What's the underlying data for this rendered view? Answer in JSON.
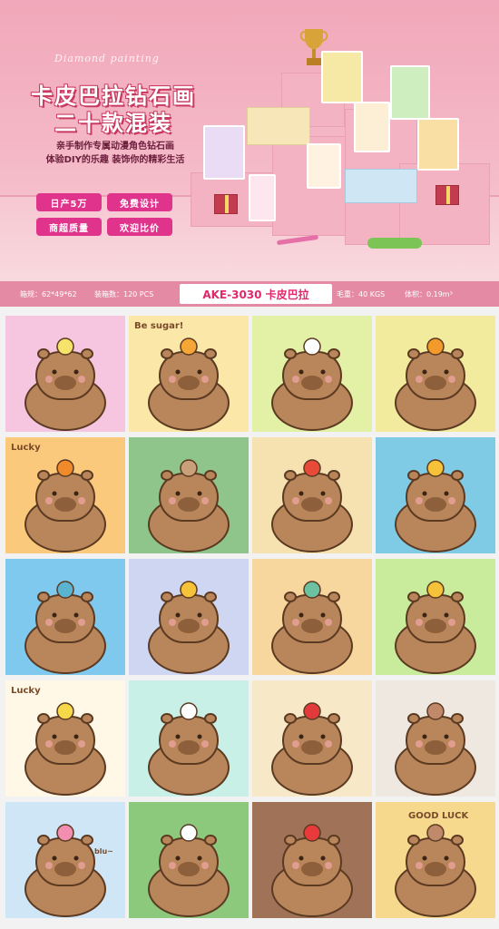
{
  "hero": {
    "brand_script": "Diamond painting",
    "title_line1": "卡皮巴拉钻石画",
    "title_line2": "二十款混装",
    "subtitle_line1": "亲手制作专属动漫角色钻石画",
    "subtitle_line2": "体验DIY的乐趣 装饰你的精彩生活",
    "badges": [
      "日产5万",
      "免费设计",
      "商超质量",
      "欢迎比价"
    ]
  },
  "info_bar": {
    "box_size": "箱规：62*49*62",
    "pcs_per_box": "装箱数：120 PCS",
    "model": "AKE-3030 卡皮巴拉",
    "weight": "毛重：40 KGS",
    "volume": "体积：0.19m³"
  },
  "tiles": [
    {
      "id": 1,
      "text": ""
    },
    {
      "id": 2,
      "text": "Be sugar!"
    },
    {
      "id": 3,
      "text": ""
    },
    {
      "id": 4,
      "text": ""
    },
    {
      "id": 5,
      "text": "Lucky"
    },
    {
      "id": 6,
      "text": ""
    },
    {
      "id": 7,
      "text": ""
    },
    {
      "id": 8,
      "text": ""
    },
    {
      "id": 9,
      "text": ""
    },
    {
      "id": 10,
      "text": ""
    },
    {
      "id": 11,
      "text": ""
    },
    {
      "id": 12,
      "text": ""
    },
    {
      "id": 13,
      "text": "Lucky"
    },
    {
      "id": 14,
      "text": ""
    },
    {
      "id": 15,
      "text": ""
    },
    {
      "id": 16,
      "text": ""
    },
    {
      "id": 17,
      "text": "blu~"
    },
    {
      "id": 18,
      "text": ""
    },
    {
      "id": 19,
      "text": ""
    },
    {
      "id": 20,
      "text": "GOOD LUCK"
    }
  ],
  "colors": {
    "banner_pink": "#f1a8b9",
    "badge_magenta": "#e0348c",
    "info_bar": "#e58aa5",
    "model_text": "#e0286b",
    "capybara_brown": "#b9855b"
  }
}
